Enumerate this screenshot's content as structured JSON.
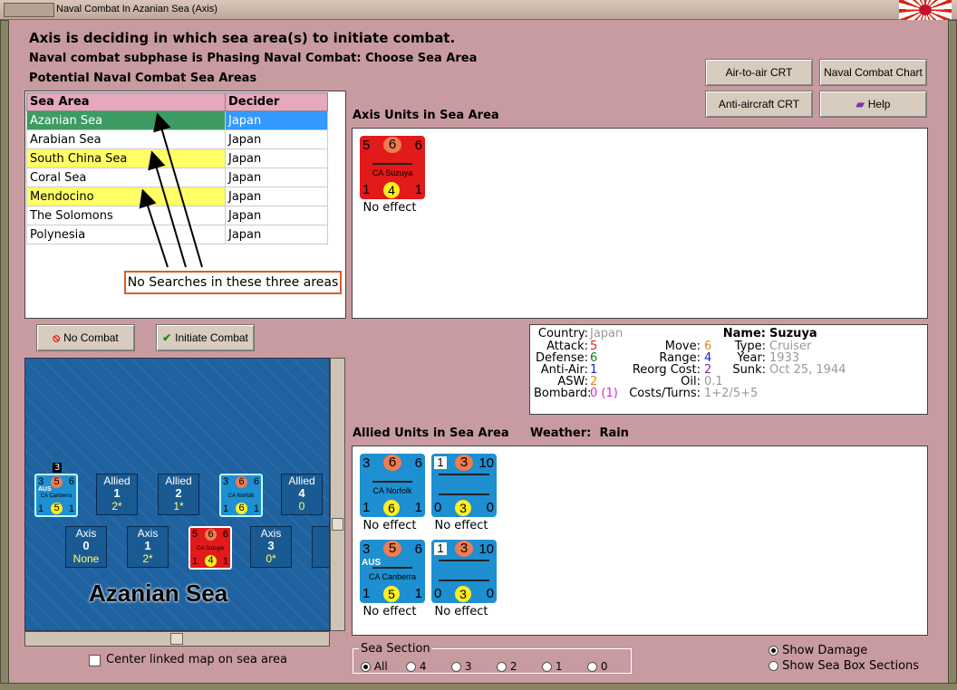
{
  "window": {
    "title": "Naval Combat In Azanian Sea (Axis)"
  },
  "header": {
    "line1": "Axis is deciding in which sea area(s) to initiate combat.",
    "line2": "Naval combat subphase is Phasing Naval Combat: Choose Sea Area",
    "line3": "Potential Naval Combat Sea Areas"
  },
  "buttons": {
    "air_to_air": "Air-to-air CRT",
    "naval_chart": "Naval Combat Chart",
    "anti_aircraft": "Anti-aircraft CRT",
    "help": "Help",
    "no_combat": "No Combat",
    "initiate_combat": "Initiate Combat"
  },
  "sea_table": {
    "columns": [
      "Sea Area",
      "Decider"
    ],
    "rows": [
      {
        "area": "Azanian Sea",
        "decider": "Japan"
      },
      {
        "area": "Arabian Sea",
        "decider": "Japan"
      },
      {
        "area": "South China Sea",
        "decider": "Japan"
      },
      {
        "area": "Coral Sea",
        "decider": "Japan"
      },
      {
        "area": "Mendocino",
        "decider": "Japan"
      },
      {
        "area": "The Solomons",
        "decider": "Japan"
      },
      {
        "area": "Polynesia",
        "decider": "Japan"
      }
    ]
  },
  "callout": "No Searches in these three areas",
  "axis_units": {
    "label": "Axis Units in Sea Area",
    "units": [
      {
        "name": "CA Suzuya",
        "tl": "5",
        "tc": "6",
        "tr": "6",
        "bl": "1",
        "bc": "4",
        "br": "1",
        "effect": "No effect"
      }
    ]
  },
  "info": {
    "country_k": "Country:",
    "country_v": "Japan",
    "attack_k": "Attack:",
    "attack_v": "5",
    "defense_k": "Defense:",
    "defense_v": "6",
    "antiair_k": "Anti-Air:",
    "antiair_v": "1",
    "asw_k": "ASW:",
    "asw_v": "2",
    "bombard_k": "Bombard:",
    "bombard_v": "0 (1)",
    "move_k": "Move:",
    "move_v": "6",
    "range_k": "Range:",
    "range_v": "4",
    "reorg_k": "Reorg Cost:",
    "reorg_v": "2",
    "oil_k": "Oil:",
    "oil_v": "0.1",
    "costs_k": "Costs/Turns:",
    "costs_v": "1+2/5+5",
    "name_k": "Name:",
    "name_v": "Suzuya",
    "type_k": "Type:",
    "type_v": "Cruiser",
    "year_k": "Year:",
    "year_v": "1933",
    "sunk_k": "Sunk:",
    "sunk_v": "Oct 25, 1944"
  },
  "allied_units": {
    "label": "Allied Units in Sea Area",
    "weather_label": "Weather:",
    "weather_value": "Rain",
    "units": [
      {
        "name": "CA Norfolk",
        "tl": "3",
        "tc": "6",
        "tr": "6",
        "bl": "1",
        "bc": "6",
        "br": "1",
        "effect": "No effect"
      },
      {
        "name": "",
        "tl": "1",
        "tc": "3",
        "tr": "10",
        "bl": "0",
        "bc": "3",
        "br": "0",
        "effect": "No effect"
      },
      {
        "name": "CA Canberra",
        "nat": "AUS",
        "tl": "3",
        "tc": "5",
        "tr": "6",
        "bl": "1",
        "bc": "5",
        "br": "1",
        "effect": "No effect"
      },
      {
        "name": "",
        "tl": "1",
        "tc": "3",
        "tr": "10",
        "bl": "0",
        "bc": "3",
        "br": "0",
        "effect": "No effect"
      }
    ]
  },
  "map": {
    "title": "Azanian Sea",
    "count_badge": "3",
    "allied_boxes": [
      {
        "side": "Allied",
        "n": "1",
        "v": "2*"
      },
      {
        "side": "Allied",
        "n": "2",
        "v": "1*"
      },
      {
        "side": "Allied",
        "n": "4",
        "v": "0"
      }
    ],
    "axis_boxes": [
      {
        "side": "Axis",
        "n": "0",
        "v": "None"
      },
      {
        "side": "Axis",
        "n": "1",
        "v": "2*"
      },
      {
        "side": "Axis",
        "n": "3",
        "v": "0*"
      }
    ],
    "mini_canberra": {
      "nat": "AUS",
      "name": "CA Canberra",
      "tl": "3",
      "tc": "5",
      "tr": "6",
      "bl": "1",
      "bc": "5",
      "br": "1"
    },
    "mini_norfolk": {
      "name": "CA Norfolk",
      "tl": "3",
      "tc": "6",
      "tr": "6",
      "bl": "1",
      "bc": "6",
      "br": "1"
    },
    "mini_suzuya": {
      "name": "CA Suzuya",
      "tl": "5",
      "tc": "6",
      "tr": "6",
      "bl": "1",
      "bc": "4",
      "br": "1"
    }
  },
  "center_map": "Center linked map on sea area",
  "sea_section": {
    "label": "Sea Section",
    "options": [
      "All",
      "4",
      "3",
      "2",
      "1",
      "0"
    ],
    "selected": "All"
  },
  "display": {
    "show_damage": "Show Damage",
    "show_sections": "Show Sea Box Sections",
    "selected": "Show Damage"
  }
}
